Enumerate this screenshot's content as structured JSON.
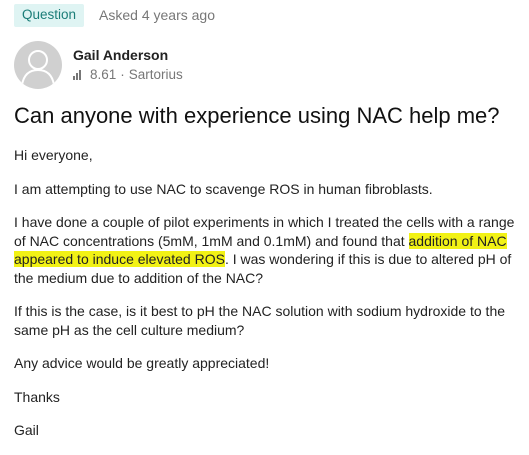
{
  "meta": {
    "badge": "Question",
    "asked": "Asked 4 years ago"
  },
  "author": {
    "name": "Gail Anderson",
    "score": "8.61",
    "separator": "·",
    "affiliation": "Sartorius"
  },
  "icons": {
    "avatar": "user-avatar-icon",
    "score": "bar-chart-icon"
  },
  "colors": {
    "badge_bg": "#dff4f3",
    "badge_text": "#1b7d78",
    "highlight": "#f2f215"
  },
  "question": {
    "title": "Can anyone with experience using NAC help me?",
    "p1": "Hi everyone,",
    "p2": "I am attempting to use NAC to scavenge ROS in human fibroblasts.",
    "p3_before": "I have done a couple of pilot experiments in which I treated the cells with a range of NAC concentrations (5mM, 1mM and 0.1mM) and found that ",
    "p3_highlight": "addition of NAC appeared to induce elevated ROS",
    "p3_after": ". I was wondering if this is due to altered pH of the medium due to addition of the NAC?",
    "p4": "If this is the case, is it best to pH the NAC solution with sodium hydroxide to the same pH as the cell culture medium?",
    "p5": "Any advice would be greatly appreciated!",
    "p6": "Thanks",
    "p7": "Gail"
  }
}
